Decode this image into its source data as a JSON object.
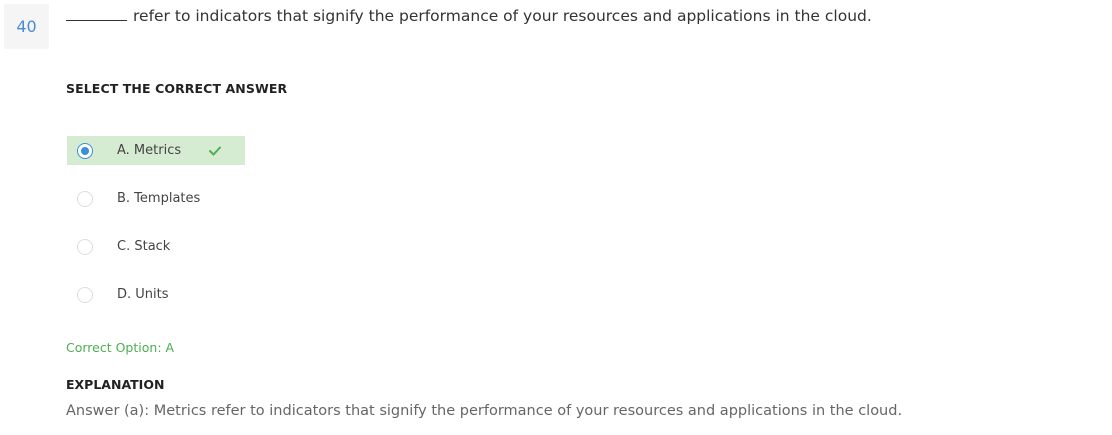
{
  "question": {
    "number": "40",
    "text": "refer to indicators that signify the performance of your resources and applications in the cloud."
  },
  "select_label": "SELECT THE CORRECT ANSWER",
  "options": [
    {
      "label": "A. Metrics",
      "selected": true,
      "correct": true
    },
    {
      "label": "B. Templates",
      "selected": false,
      "correct": false
    },
    {
      "label": "C. Stack",
      "selected": false,
      "correct": false
    },
    {
      "label": "D. Units",
      "selected": false,
      "correct": false
    }
  ],
  "correct_option": "Correct Option: A",
  "explanation": {
    "title": "EXPLANATION",
    "text": "Answer (a): Metrics refer to indicators that signify the performance of your resources and applications in the cloud."
  },
  "colors": {
    "accent": "#3a8fd9",
    "correct_bg": "#d5ecd2",
    "correct_text": "#4caf50"
  }
}
